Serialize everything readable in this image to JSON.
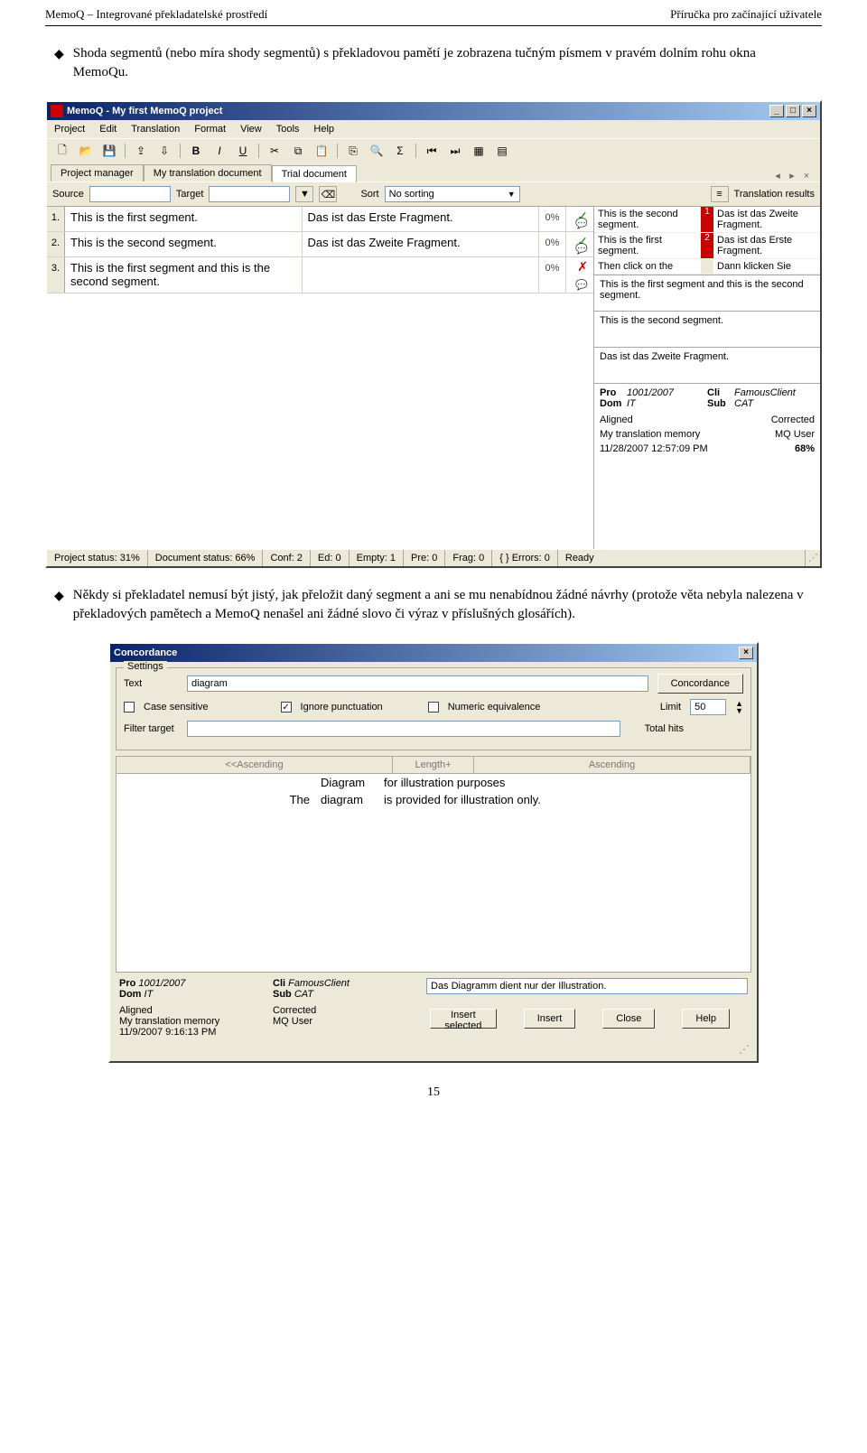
{
  "page": {
    "header_left": "MemoQ – Integrované překladatelské prostředí",
    "header_right": "Příručka pro začínající uživatele",
    "bullet1": "Shoda segmentů (nebo míra shody segmentů) s překladovou pamětí je zobrazena tučným písmem v pravém dolním rohu okna MemoQu.",
    "bullet2": "Někdy si překladatel nemusí být jistý, jak přeložit daný segment a ani se mu nenabídnou žádné návrhy (protože věta nebyla nalezena v překladových pamětech a MemoQ nenašel ani žádné slovo či výraz v příslušných glosářích).",
    "number": "15"
  },
  "app": {
    "title": "MemoQ - My first MemoQ project",
    "menus": [
      "Project",
      "Edit",
      "Translation",
      "Format",
      "View",
      "Tools",
      "Help"
    ],
    "tabs": [
      "Project manager",
      "My translation document",
      "Trial document"
    ],
    "filter": {
      "source_lbl": "Source",
      "target_lbl": "Target",
      "sort_lbl": "Sort",
      "sort_val": "No sorting",
      "results_lbl": "Translation results"
    },
    "rows": [
      {
        "n": "1.",
        "src": "This is the first segment.",
        "tgt": "Das ist das Erste Fragment.",
        "pc": "0%",
        "ok": true
      },
      {
        "n": "2.",
        "src": "This is the second segment.",
        "tgt": "Das ist das Zweite Fragment.",
        "pc": "0%",
        "ok": true
      },
      {
        "n": "3.",
        "src": "This is the first segment and this is the second segment.",
        "tgt": "",
        "pc": "0%",
        "ok": false
      }
    ],
    "results": [
      {
        "n": "1",
        "src": "This is the second segment.",
        "tgt": "Das ist das Zweite Fragment."
      },
      {
        "n": "2",
        "src": "This is the first segment.",
        "tgt": "Das ist das Erste Fragment."
      },
      {
        "n": "",
        "src": "Then click on the",
        "tgt": "Dann klicken Sie"
      }
    ],
    "res_src": "This is the first segment and this is the second segment.",
    "res_mid": "This is the second segment.",
    "res_tgt": "Das ist das Zweite Fragment.",
    "meta": {
      "pro_l": "Pro",
      "pro_v": "1001/2007",
      "cli_l": "Cli",
      "cli_v": "FamousClient",
      "dom_l": "Dom",
      "dom_v": "IT",
      "sub_l": "Sub",
      "sub_v": "CAT",
      "aligned": "Aligned",
      "corrected": "Corrected",
      "mem": "My translation memory",
      "user": "MQ User",
      "date": "11/28/2007 12:57:09 PM",
      "score": "68%"
    },
    "status": {
      "ps": "Project status: 31%",
      "ds": "Document status: 66%",
      "conf": "Conf: 2",
      "ed": "Ed: 0",
      "empty": "Empty: 1",
      "pre": "Pre: 0",
      "frag": "Frag: 0",
      "err": "{ } Errors: 0",
      "ready": "Ready"
    }
  },
  "conc": {
    "title": "Concordance",
    "settings": "Settings",
    "text_lbl": "Text",
    "text_val": "diagram",
    "btn": "Concordance",
    "case": "Case sensitive",
    "ignore": "Ignore punctuation",
    "numeric": "Numeric equivalence",
    "limit_lbl": "Limit",
    "limit_val": "50",
    "filter": "Filter target",
    "total": "Total hits",
    "hdrs": [
      "<<Ascending",
      "Length+",
      "Ascending"
    ],
    "rows": [
      {
        "l": "",
        "m": "Diagram",
        "r": "for illustration purposes"
      },
      {
        "l": "The",
        "m": "diagram",
        "r": "is provided for illustration only."
      }
    ],
    "meta": {
      "pro_l": "Pro",
      "pro_v": "1001/2007",
      "cli_l": "Cli",
      "cli_v": "FamousClient",
      "dom_l": "Dom",
      "dom_v": "IT",
      "sub_l": "Sub",
      "sub_v": "CAT",
      "target": "Das Diagramm dient nur der Illustration.",
      "aligned": "Aligned",
      "corrected": "Corrected",
      "mem": "My translation memory",
      "user": "MQ User",
      "date": "11/9/2007 9:16:13 PM"
    },
    "btns": [
      "Insert selected",
      "Insert",
      "Close",
      "Help"
    ]
  }
}
